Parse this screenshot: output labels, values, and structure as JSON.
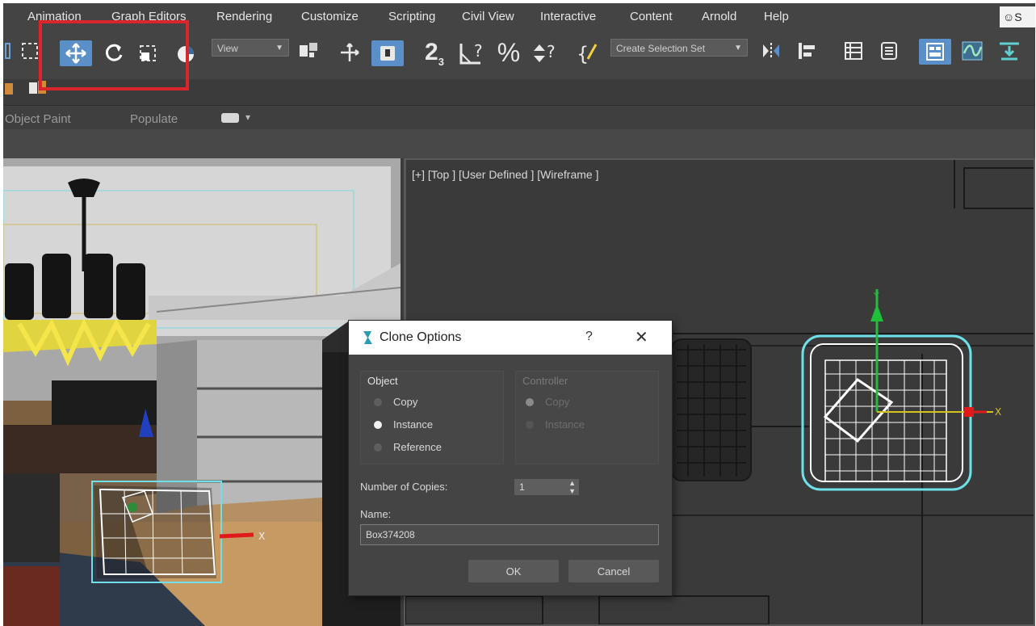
{
  "menubar": {
    "items": [
      "Animation",
      "Graph Editors",
      "Rendering",
      "Customize",
      "Scripting",
      "Civil View",
      "Interactive",
      "Content",
      "Arnold",
      "Help"
    ],
    "account_label": "S"
  },
  "toolbar": {
    "view_dropdown": "View",
    "selection_set_dropdown": "Create Selection Set",
    "snap_label": "2",
    "snap_sub": "3",
    "percent_label": "%",
    "tools": [
      "select-region-icon",
      "move-icon",
      "rotate-icon",
      "scale-icon",
      "place-icon",
      "snap-3d-icon",
      "angle-snap-icon",
      "percent-snap-icon",
      "spinner-snap-icon",
      "edit-named-sets-icon",
      "mirror-icon",
      "align-icon",
      "scene-explorer-icon",
      "layer-explorer-icon",
      "ribbon-toggle-icon",
      "curve-editor-icon",
      "render-icon"
    ],
    "active_tool": "move-icon",
    "highlight_color": "#d9262a",
    "active_color": "#5b8fc7"
  },
  "ribbon": {
    "items": [
      "Object Paint",
      "Populate"
    ]
  },
  "viewport_right": {
    "label": "[+] [Top ] [User Defined ] [Wireframe ]",
    "axis_x": "X",
    "axis_y": "Y"
  },
  "viewport_left": {
    "axis_x": "X"
  },
  "dialog": {
    "title": "Clone Options",
    "help": "?",
    "close": "✕",
    "object_group": {
      "label": "Object",
      "options": [
        "Copy",
        "Instance",
        "Reference"
      ],
      "selected": "Instance"
    },
    "controller_group": {
      "label": "Controller",
      "options": [
        "Copy",
        "Instance"
      ],
      "selected": "Copy",
      "disabled": true
    },
    "copies_label": "Number of Copies:",
    "copies_value": "1",
    "name_label": "Name:",
    "name_value": "Box374208",
    "ok_label": "OK",
    "cancel_label": "Cancel"
  }
}
